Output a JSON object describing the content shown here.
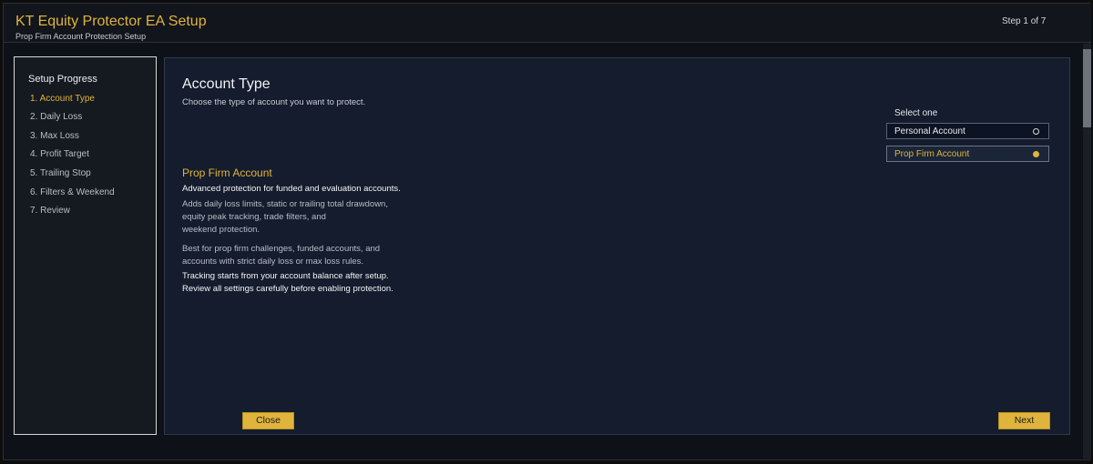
{
  "header": {
    "title": "KT Equity Protector EA Setup",
    "subtitle": "Prop Firm Account Protection Setup",
    "step": "Step 1 of 7"
  },
  "sidebar": {
    "title": "Setup Progress",
    "steps": [
      "1. Account Type",
      "2. Daily Loss",
      "3. Max Loss",
      "4. Profit Target",
      "5. Trailing Stop",
      "6. Filters & Weekend",
      "7. Review"
    ],
    "active_index": 0
  },
  "main": {
    "title": "Account Type",
    "description": "Choose the type of account you want to protect.",
    "select_label": "Select one",
    "options": [
      {
        "label": "Personal Account",
        "selected": false
      },
      {
        "label": "Prop Firm Account",
        "selected": true
      }
    ],
    "info": {
      "title": "Prop Firm Account",
      "lead": "Advanced protection for funded and evaluation accounts.",
      "details": [
        "Adds daily loss limits, static or trailing total drawdown,",
        "equity peak tracking, trade filters, and",
        "weekend protection."
      ],
      "best_for": [
        "Best for prop firm challenges, funded accounts, and",
        "accounts with strict daily loss or max loss rules."
      ],
      "notes": [
        "Tracking starts from your account balance after setup.",
        "Review all settings carefully before enabling protection."
      ]
    },
    "buttons": {
      "close": "Close",
      "next": "Next"
    }
  },
  "colors": {
    "accent": "#e0b43c",
    "panel": "#141c2d",
    "background": "#0e1218"
  }
}
